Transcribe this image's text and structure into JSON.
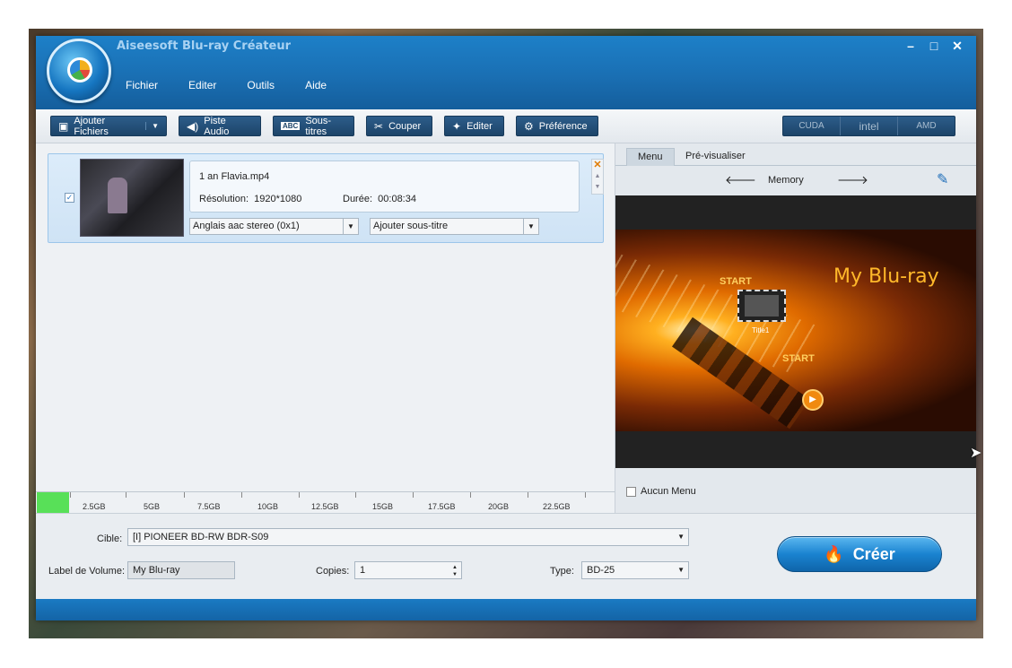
{
  "window": {
    "title": "Aiseesoft Blu-ray Créateur",
    "controls": [
      "–",
      "□",
      "✕"
    ]
  },
  "menu": [
    "Fichier",
    "Editer",
    "Outils",
    "Aide"
  ],
  "toolbar": {
    "add_files": "Ajouter Fichiers",
    "audio_track": "Piste Audio",
    "subtitles": "Sous-titres",
    "cut": "Couper",
    "edit": "Editer",
    "preference": "Préférence",
    "gpu": [
      "CUDA",
      "intel",
      "AMD"
    ]
  },
  "file_item": {
    "checked": true,
    "name": "1 an Flavia.mp4",
    "resolution_label": "Résolution:",
    "resolution": "1920*1080",
    "duration_label": "Durée:",
    "duration": "00:08:34",
    "audio": "Anglais aac stereo (0x1)",
    "subtitle": "Ajouter sous-titre"
  },
  "capacity": {
    "fill_fraction": 0.055,
    "ticks": [
      "2.5GB",
      "5GB",
      "7.5GB",
      "10GB",
      "12.5GB",
      "15GB",
      "17.5GB",
      "20GB",
      "22.5GB"
    ]
  },
  "preview": {
    "tabs": [
      "Menu",
      "Pré-visualiser"
    ],
    "template_name": "Memory",
    "menu_title": "My Blu-ray",
    "start1": "START",
    "start2": "START",
    "title_label": "Title1",
    "no_menu": "Aucun Menu"
  },
  "bottom": {
    "target_label": "Cible:",
    "target_value": "[I] PIONEER BD-RW   BDR-S09",
    "volume_label": "Label de Volume:",
    "volume_value": "My Blu-ray",
    "copies_label": "Copies:",
    "copies_value": "1",
    "type_label": "Type:",
    "type_value": "BD-25",
    "create_button": "Créer"
  }
}
